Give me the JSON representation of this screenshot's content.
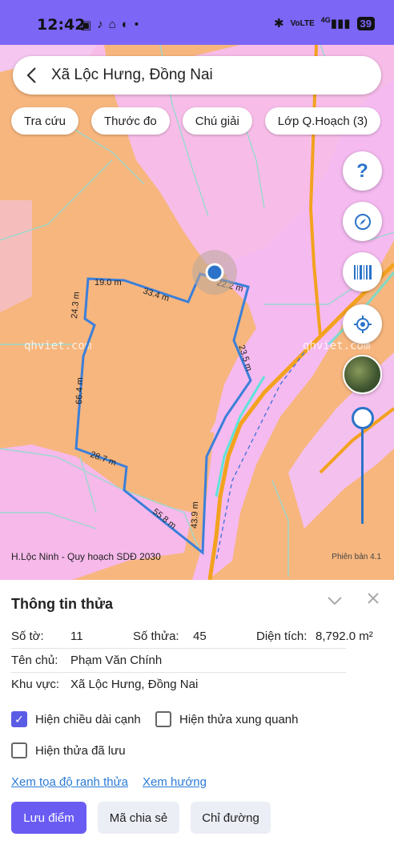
{
  "status_bar": {
    "time": "12:42",
    "network": "VoLTE",
    "signal": "4G",
    "battery": "39"
  },
  "search": {
    "title": "Xã Lộc Hưng, Đồng Nai"
  },
  "chips": [
    "Tra cứu",
    "Thước đo",
    "Chú giải",
    "Lớp Q.Hoạch (3)"
  ],
  "fabs": {
    "help": "?"
  },
  "map": {
    "parcel_color": "#3b7fd9",
    "edge_labels": [
      "19.0 m",
      "33.4 m",
      "22.2 m",
      "24.3 m",
      "23.5 m",
      "66.4 m",
      "28.7 m",
      "55.8 m",
      "43.9 m"
    ],
    "watermark": "qhviet.com",
    "caption": "H.Lộc Ninh - Quy hoạch SDĐ 2030",
    "version": "Phiên bản 4.1"
  },
  "panel": {
    "title": "Thông tin thửa",
    "so_to_label": "Số tờ:",
    "so_to_value": "11",
    "so_thua_label": "Số thửa:",
    "so_thua_value": "45",
    "dien_tich_label": "Diện tích:",
    "dien_tich_value": "8,792.0 m²",
    "ten_chu_label": "Tên chủ:",
    "ten_chu_value": "Phạm Văn Chính",
    "khu_vuc_label": "Khu vực:",
    "khu_vuc_value": "Xã Lộc Hưng, Đồng Nai",
    "cb_edge_lengths": "Hiện chiều dài cạnh",
    "cb_nearby": "Hiện thửa xung quanh",
    "cb_saved": "Hiện thửa đã lưu",
    "link_coords": "Xem tọa độ ranh thửa",
    "link_direction": "Xem hướng",
    "btn_save": "Lưu điểm",
    "btn_share": "Mã chia sẻ",
    "btn_route": "Chỉ đường"
  }
}
